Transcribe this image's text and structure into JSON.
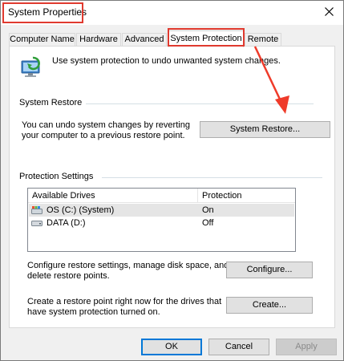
{
  "window": {
    "title": "System Properties"
  },
  "tabs": [
    {
      "label": "Computer Name"
    },
    {
      "label": "Hardware"
    },
    {
      "label": "Advanced"
    },
    {
      "label": "System Protection"
    },
    {
      "label": "Remote"
    }
  ],
  "intro": {
    "text": "Use system protection to undo unwanted system changes."
  },
  "system_restore": {
    "group_label": "System Restore",
    "description_line1": "You can undo system changes by reverting",
    "description_line2": "your computer to a previous restore point.",
    "button_label": "System Restore..."
  },
  "protection_settings": {
    "group_label": "Protection Settings",
    "columns": [
      "Available Drives",
      "Protection"
    ],
    "drives": [
      {
        "name": "OS (C:) (System)",
        "protection": "On",
        "icon": "system-drive-icon"
      },
      {
        "name": "DATA (D:)",
        "protection": "Off",
        "icon": "hard-drive-icon"
      }
    ]
  },
  "configure": {
    "line1": "Configure restore settings, manage disk space, and",
    "line2": "delete restore points.",
    "button_label": "Configure..."
  },
  "create": {
    "line1": "Create a restore point right now for the drives that",
    "line2": "have system protection turned on.",
    "button_label": "Create..."
  },
  "footer": {
    "ok": "OK",
    "cancel": "Cancel",
    "apply": "Apply"
  },
  "colors": {
    "highlight": "#e03a2f",
    "accent": "#0078d7"
  }
}
